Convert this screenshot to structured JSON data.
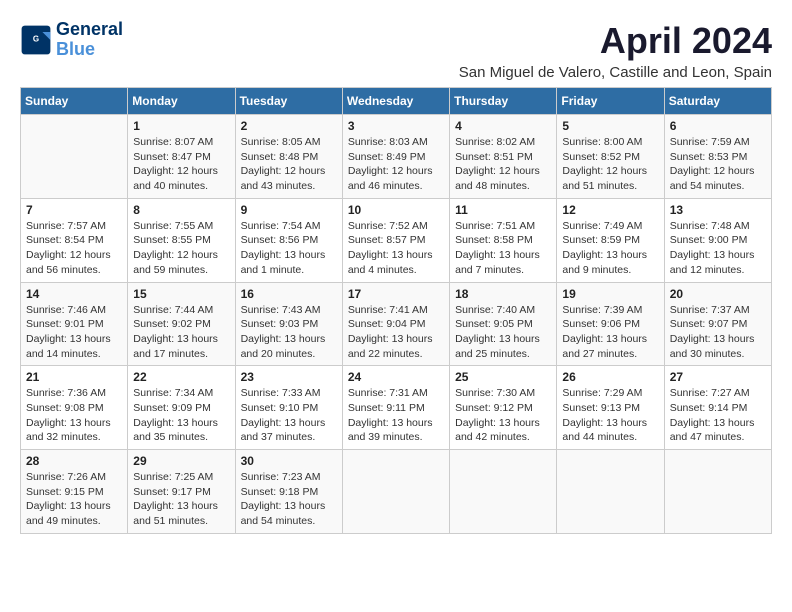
{
  "logo": {
    "text_general": "General",
    "text_blue": "Blue"
  },
  "title": "April 2024",
  "subtitle": "San Miguel de Valero, Castille and Leon, Spain",
  "days_of_week": [
    "Sunday",
    "Monday",
    "Tuesday",
    "Wednesday",
    "Thursday",
    "Friday",
    "Saturday"
  ],
  "weeks": [
    [
      {
        "day": "",
        "info": ""
      },
      {
        "day": "1",
        "info": "Sunrise: 8:07 AM\nSunset: 8:47 PM\nDaylight: 12 hours\nand 40 minutes."
      },
      {
        "day": "2",
        "info": "Sunrise: 8:05 AM\nSunset: 8:48 PM\nDaylight: 12 hours\nand 43 minutes."
      },
      {
        "day": "3",
        "info": "Sunrise: 8:03 AM\nSunset: 8:49 PM\nDaylight: 12 hours\nand 46 minutes."
      },
      {
        "day": "4",
        "info": "Sunrise: 8:02 AM\nSunset: 8:51 PM\nDaylight: 12 hours\nand 48 minutes."
      },
      {
        "day": "5",
        "info": "Sunrise: 8:00 AM\nSunset: 8:52 PM\nDaylight: 12 hours\nand 51 minutes."
      },
      {
        "day": "6",
        "info": "Sunrise: 7:59 AM\nSunset: 8:53 PM\nDaylight: 12 hours\nand 54 minutes."
      }
    ],
    [
      {
        "day": "7",
        "info": "Sunrise: 7:57 AM\nSunset: 8:54 PM\nDaylight: 12 hours\nand 56 minutes."
      },
      {
        "day": "8",
        "info": "Sunrise: 7:55 AM\nSunset: 8:55 PM\nDaylight: 12 hours\nand 59 minutes."
      },
      {
        "day": "9",
        "info": "Sunrise: 7:54 AM\nSunset: 8:56 PM\nDaylight: 13 hours\nand 1 minute."
      },
      {
        "day": "10",
        "info": "Sunrise: 7:52 AM\nSunset: 8:57 PM\nDaylight: 13 hours\nand 4 minutes."
      },
      {
        "day": "11",
        "info": "Sunrise: 7:51 AM\nSunset: 8:58 PM\nDaylight: 13 hours\nand 7 minutes."
      },
      {
        "day": "12",
        "info": "Sunrise: 7:49 AM\nSunset: 8:59 PM\nDaylight: 13 hours\nand 9 minutes."
      },
      {
        "day": "13",
        "info": "Sunrise: 7:48 AM\nSunset: 9:00 PM\nDaylight: 13 hours\nand 12 minutes."
      }
    ],
    [
      {
        "day": "14",
        "info": "Sunrise: 7:46 AM\nSunset: 9:01 PM\nDaylight: 13 hours\nand 14 minutes."
      },
      {
        "day": "15",
        "info": "Sunrise: 7:44 AM\nSunset: 9:02 PM\nDaylight: 13 hours\nand 17 minutes."
      },
      {
        "day": "16",
        "info": "Sunrise: 7:43 AM\nSunset: 9:03 PM\nDaylight: 13 hours\nand 20 minutes."
      },
      {
        "day": "17",
        "info": "Sunrise: 7:41 AM\nSunset: 9:04 PM\nDaylight: 13 hours\nand 22 minutes."
      },
      {
        "day": "18",
        "info": "Sunrise: 7:40 AM\nSunset: 9:05 PM\nDaylight: 13 hours\nand 25 minutes."
      },
      {
        "day": "19",
        "info": "Sunrise: 7:39 AM\nSunset: 9:06 PM\nDaylight: 13 hours\nand 27 minutes."
      },
      {
        "day": "20",
        "info": "Sunrise: 7:37 AM\nSunset: 9:07 PM\nDaylight: 13 hours\nand 30 minutes."
      }
    ],
    [
      {
        "day": "21",
        "info": "Sunrise: 7:36 AM\nSunset: 9:08 PM\nDaylight: 13 hours\nand 32 minutes."
      },
      {
        "day": "22",
        "info": "Sunrise: 7:34 AM\nSunset: 9:09 PM\nDaylight: 13 hours\nand 35 minutes."
      },
      {
        "day": "23",
        "info": "Sunrise: 7:33 AM\nSunset: 9:10 PM\nDaylight: 13 hours\nand 37 minutes."
      },
      {
        "day": "24",
        "info": "Sunrise: 7:31 AM\nSunset: 9:11 PM\nDaylight: 13 hours\nand 39 minutes."
      },
      {
        "day": "25",
        "info": "Sunrise: 7:30 AM\nSunset: 9:12 PM\nDaylight: 13 hours\nand 42 minutes."
      },
      {
        "day": "26",
        "info": "Sunrise: 7:29 AM\nSunset: 9:13 PM\nDaylight: 13 hours\nand 44 minutes."
      },
      {
        "day": "27",
        "info": "Sunrise: 7:27 AM\nSunset: 9:14 PM\nDaylight: 13 hours\nand 47 minutes."
      }
    ],
    [
      {
        "day": "28",
        "info": "Sunrise: 7:26 AM\nSunset: 9:15 PM\nDaylight: 13 hours\nand 49 minutes."
      },
      {
        "day": "29",
        "info": "Sunrise: 7:25 AM\nSunset: 9:17 PM\nDaylight: 13 hours\nand 51 minutes."
      },
      {
        "day": "30",
        "info": "Sunrise: 7:23 AM\nSunset: 9:18 PM\nDaylight: 13 hours\nand 54 minutes."
      },
      {
        "day": "",
        "info": ""
      },
      {
        "day": "",
        "info": ""
      },
      {
        "day": "",
        "info": ""
      },
      {
        "day": "",
        "info": ""
      }
    ]
  ]
}
